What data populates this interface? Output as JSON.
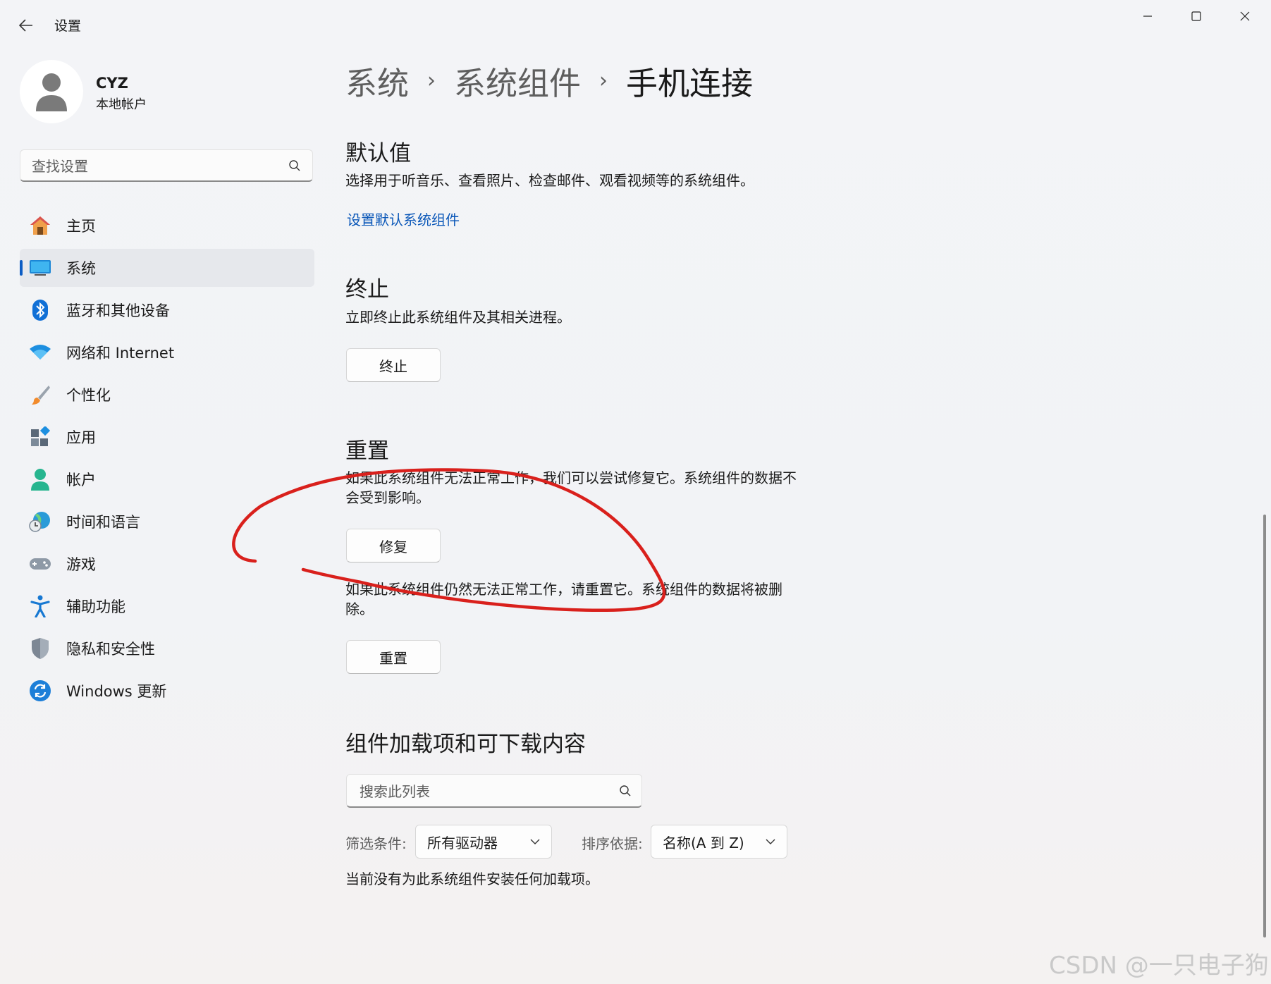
{
  "window": {
    "title": "设置"
  },
  "sidebar": {
    "user": {
      "name": "CYZ",
      "account_type": "本地帐户"
    },
    "search_placeholder": "查找设置",
    "items": [
      {
        "label": "主页",
        "icon": "home-icon",
        "selected": false
      },
      {
        "label": "系统",
        "icon": "system-display-icon",
        "selected": true
      },
      {
        "label": "蓝牙和其他设备",
        "icon": "bluetooth-icon",
        "selected": false
      },
      {
        "label": "网络和 Internet",
        "icon": "wifi-icon",
        "selected": false
      },
      {
        "label": "个性化",
        "icon": "brush-icon",
        "selected": false
      },
      {
        "label": "应用",
        "icon": "apps-icon",
        "selected": false
      },
      {
        "label": "帐户",
        "icon": "account-icon",
        "selected": false
      },
      {
        "label": "时间和语言",
        "icon": "globe-clock-icon",
        "selected": false
      },
      {
        "label": "游戏",
        "icon": "gamepad-icon",
        "selected": false
      },
      {
        "label": "辅助功能",
        "icon": "accessibility-icon",
        "selected": false
      },
      {
        "label": "隐私和安全性",
        "icon": "shield-icon",
        "selected": false
      },
      {
        "label": "Windows 更新",
        "icon": "update-icon",
        "selected": false
      }
    ]
  },
  "breadcrumb": [
    "系统",
    "系统组件",
    "手机连接"
  ],
  "defaults": {
    "title": "默认值",
    "description": "选择用于听音乐、查看照片、检查邮件、观看视频等的系统组件。",
    "link": "设置默认系统组件"
  },
  "terminate": {
    "title": "终止",
    "description": "立即终止此系统组件及其相关进程。",
    "button": "终止"
  },
  "reset": {
    "title": "重置",
    "repair_description_line1": "如果此系统组件无法正常工作，我们可以尝试修复它。系统组件的数据不",
    "repair_description_line2": "会受到影响。",
    "repair_button": "修复",
    "reset_description_line1": "如果此系统组件仍然无法正常工作，请重置它。系统组件的数据将被删",
    "reset_description_line2": "除。",
    "reset_button": "重置"
  },
  "addons": {
    "title": "组件加载项和可下载内容",
    "search_placeholder": "搜索此列表",
    "filter_label": "筛选条件:",
    "filter_value": "所有驱动器",
    "sort_label": "排序依据:",
    "sort_value": "名称(A 到 Z)",
    "empty_note": "当前没有为此系统组件安装任何加载项。"
  },
  "watermark": "CSDN @一只电子狗",
  "colors": {
    "accent": "#0b5cc4",
    "link": "#0a57b8",
    "annotation": "#d9201c"
  }
}
